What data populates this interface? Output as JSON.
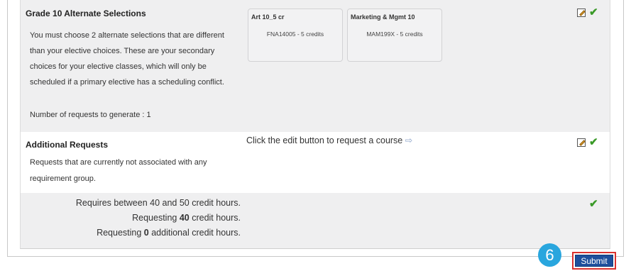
{
  "grade10": {
    "title": "Grade 10 Alternate Selections",
    "description": "You must choose 2 alternate selections that are different than your elective choices. These are your secondary choices for your elective classes, which will only be scheduled if a primary elective has a scheduling conflict.",
    "num_requests": "Number of requests to generate : 1",
    "courses": [
      {
        "title": "Art 10_5 cr",
        "code": "FNA14005 - 5 credits"
      },
      {
        "title": "Marketing & Mgmt 10",
        "code": "MAM199X - 5 credits"
      }
    ]
  },
  "additional": {
    "title": "Additional Requests",
    "description": "Requests that are currently not associated with any requirement group.",
    "hint": "Click the edit button to request a course",
    "hint_arrow": "⇨"
  },
  "summary": {
    "line1": "Requires between 40 and 50 credit hours.",
    "line2_prefix": "Requesting ",
    "line2_value": "40",
    "line2_suffix": " credit hours.",
    "line3_prefix": "Requesting ",
    "line3_value": "0",
    "line3_suffix": " additional credit hours."
  },
  "icons": {
    "edit": "edit-pencil-icon",
    "check": "✔"
  },
  "colors": {
    "check": "#3a9a28",
    "submit_bg": "#1d4f9c",
    "highlight": "#d9312e",
    "step_badge": "#29a6de"
  },
  "step": "6",
  "submit_label": "Submit"
}
